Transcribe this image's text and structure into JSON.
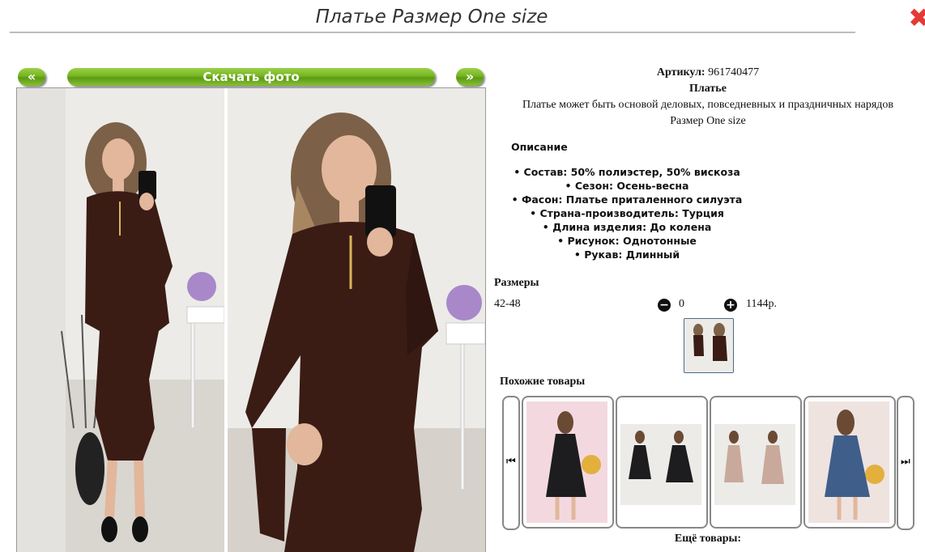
{
  "header": {
    "title": "Платье Размер One size",
    "close_icon": "close-icon"
  },
  "gallery": {
    "prev_label": "«",
    "download_label": "Скачать фото",
    "next_label": "»"
  },
  "product": {
    "sku_label": "Артикул:",
    "sku": "961740477",
    "name": "Платье",
    "summary": "Платье может быть основой деловых, повседневных и праздничных нарядов",
    "size_text": "Размер One size"
  },
  "description": {
    "heading": "Описание",
    "items": [
      "Состав: 50% полиэстер, 50% вискоза",
      "Сезон: Осень-весна",
      "Фасон: Платье приталенного силуэта",
      "Страна-производитель: Турция",
      "Длина изделия: До колена",
      "Рисунок: Однотонные",
      "Рукав: Длинный"
    ]
  },
  "sizes": {
    "heading": "Размеры",
    "rows": [
      {
        "size": "42-48",
        "qty": "0",
        "price": "1144р."
      }
    ]
  },
  "similar": {
    "heading": "Похожие товары",
    "more_label": "Ещё товары:"
  },
  "colors": {
    "button_green": "#74b51f",
    "dress": "#3a1c14",
    "close": "#e53935"
  }
}
